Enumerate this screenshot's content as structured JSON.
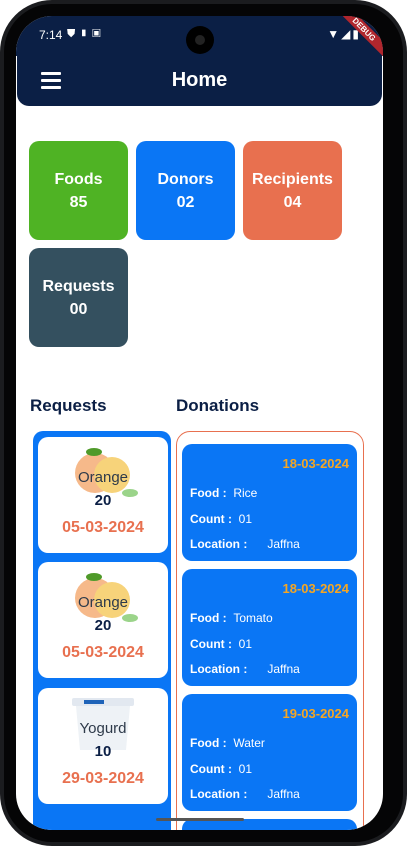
{
  "status_bar": {
    "time": "7:14",
    "debug_label": "DEBUG"
  },
  "appbar": {
    "title": "Home"
  },
  "stats": [
    {
      "label": "Foods",
      "value": "85",
      "color": "#4fb324"
    },
    {
      "label": "Donors",
      "value": "02",
      "color": "#0a76f5"
    },
    {
      "label": "Recipients",
      "value": "04",
      "color": "#e8704f"
    },
    {
      "label": "Requests",
      "value": "00",
      "color": "#34505f"
    }
  ],
  "sections": {
    "requests_title": "Requests",
    "donations_title": "Donations"
  },
  "requests": [
    {
      "name": "Orange",
      "count": "20",
      "date": "05-03-2024",
      "icon": "orange-fruit-icon"
    },
    {
      "name": "Orange",
      "count": "20",
      "date": "05-03-2024",
      "icon": "orange-fruit-icon"
    },
    {
      "name": "Yogurd",
      "count": "10",
      "date": "29-03-2024",
      "icon": "yogurt-cup-icon"
    }
  ],
  "donations": [
    {
      "date": "18-03-2024",
      "food_label": "Food :",
      "food": "Rice",
      "count_label": "Count :",
      "count": "01",
      "location_label": "Location :",
      "location": "Jaffna"
    },
    {
      "date": "18-03-2024",
      "food_label": "Food :",
      "food": "Tomato",
      "count_label": "Count :",
      "count": "01",
      "location_label": "Location :",
      "location": "Jaffna"
    },
    {
      "date": "19-03-2024",
      "food_label": "Food :",
      "food": "Water",
      "count_label": "Count :",
      "count": "01",
      "location_label": "Location :",
      "location": "Jaffna"
    }
  ]
}
